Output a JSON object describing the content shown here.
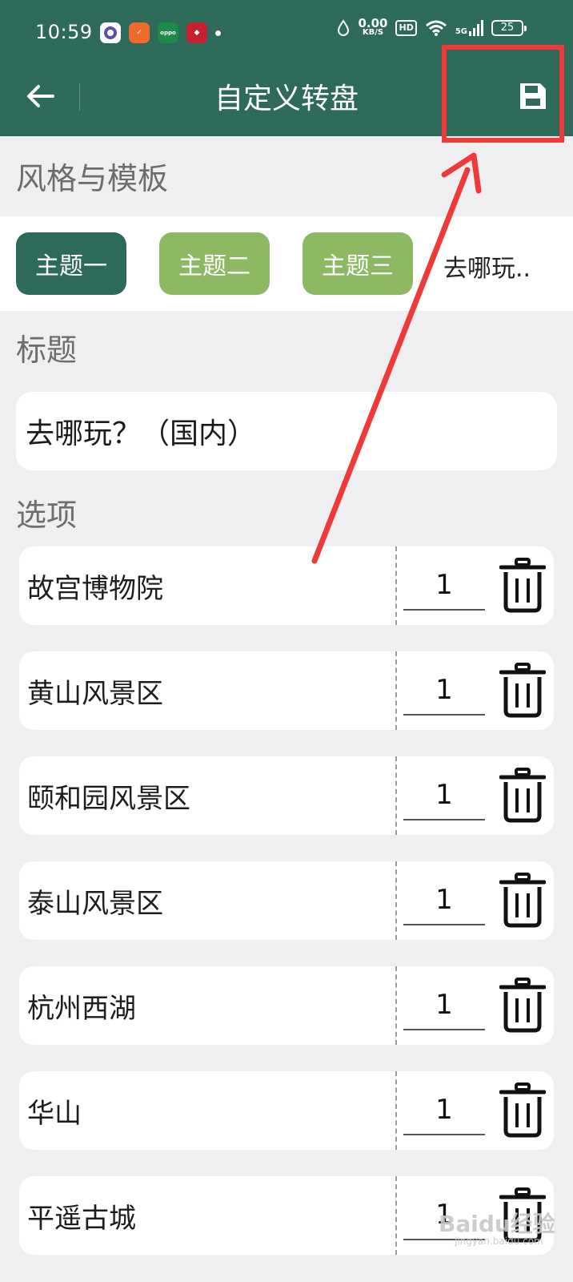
{
  "status_bar": {
    "time": "10:59",
    "net_speed_value": "0.00",
    "net_speed_unit": "KB/S",
    "hd_label": "HD",
    "network_label": "5G",
    "battery_level": "25"
  },
  "app_bar": {
    "title": "自定义转盘",
    "back_icon": "arrow-left-icon",
    "save_icon": "floppy-disk-icon"
  },
  "sections": {
    "style_label": "风格与模板",
    "title_label": "标题",
    "options_label": "选项"
  },
  "themes": [
    {
      "label": "主题一",
      "active": true
    },
    {
      "label": "主题二",
      "active": false
    },
    {
      "label": "主题三",
      "active": false
    }
  ],
  "theme_template_text": "去哪玩..",
  "title_value": "去哪玩？（国内）",
  "options": [
    {
      "name": "故宫博物院",
      "weight": "1"
    },
    {
      "name": "黄山风景区",
      "weight": "1"
    },
    {
      "name": "颐和园风景区",
      "weight": "1"
    },
    {
      "name": "泰山风景区",
      "weight": "1"
    },
    {
      "name": "杭州西湖",
      "weight": "1"
    },
    {
      "name": "华山",
      "weight": "1"
    },
    {
      "name": "平遥古城",
      "weight": "1"
    }
  ],
  "colors": {
    "primary": "#2d6a5a",
    "theme_inactive": "#8db962",
    "annotation_red": "#f03a3a",
    "background": "#efeff2"
  },
  "watermark": {
    "text": "Baidu经验",
    "sub": "jingyan.baidu.com"
  }
}
